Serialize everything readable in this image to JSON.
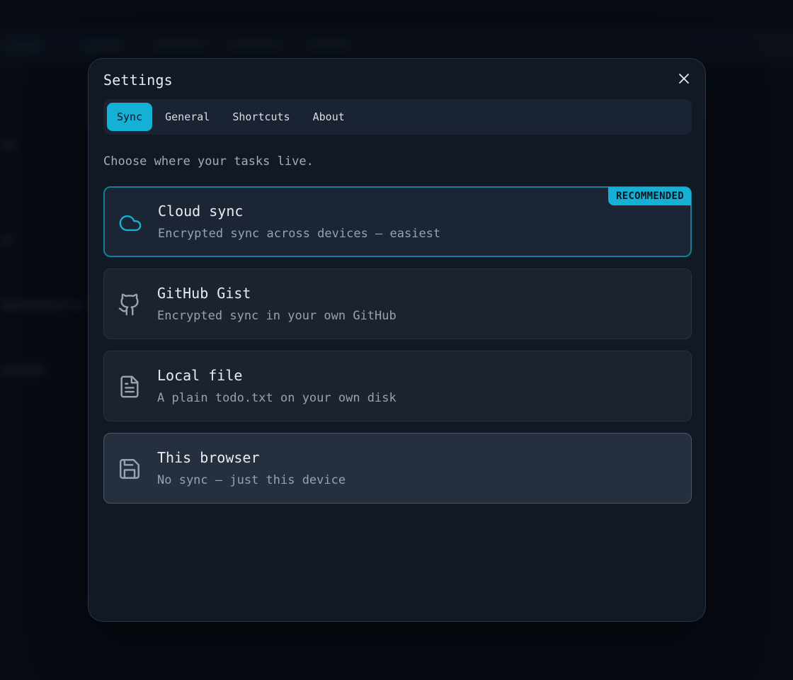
{
  "dialog": {
    "title": "Settings",
    "intro": "Choose where your tasks live."
  },
  "tabs": [
    {
      "label": "Sync",
      "active": true
    },
    {
      "label": "General",
      "active": false
    },
    {
      "label": "Shortcuts",
      "active": false
    },
    {
      "label": "About",
      "active": false
    }
  ],
  "options": [
    {
      "title": "Cloud sync",
      "description": "Encrypted sync across devices — easiest",
      "icon": "cloud-icon",
      "badge": "RECOMMENDED"
    },
    {
      "title": "GitHub Gist",
      "description": "Encrypted sync in your own GitHub",
      "icon": "github-icon"
    },
    {
      "title": "Local file",
      "description": "A plain todo.txt on your own disk",
      "icon": "file-text-icon"
    },
    {
      "title": "This browser",
      "description": "No sync — just this device",
      "icon": "floppy-disk-icon",
      "selected": true
    }
  ],
  "colors": {
    "accent": "#14b0d6",
    "modal_bg": "#111924",
    "card_bg": "#1b2330",
    "selected_card_bg": "#252f3d"
  }
}
